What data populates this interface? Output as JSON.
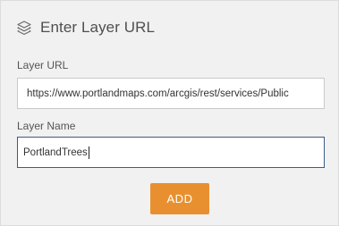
{
  "dialog": {
    "title": "Enter Layer URL",
    "icon": "layers-icon"
  },
  "layer_url": {
    "label": "Layer URL",
    "value": "https://www.portlandmaps.com/arcgis/rest/services/Public"
  },
  "layer_name": {
    "label": "Layer Name",
    "value": "PortlandTrees"
  },
  "actions": {
    "add_label": "ADD"
  },
  "colors": {
    "accent": "#e8902f",
    "focus_border": "#3b5c8a",
    "panel_bg": "#f1f1f1"
  }
}
